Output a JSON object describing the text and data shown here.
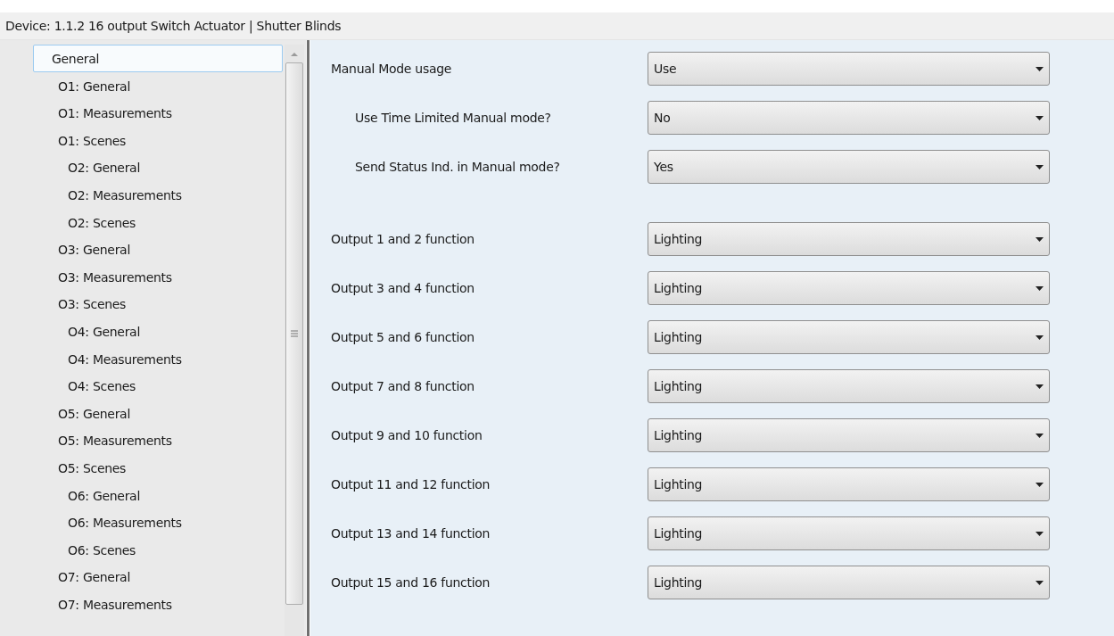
{
  "header": {
    "title": "Device: 1.1.2  16 output Switch Actuator | Shutter Blinds"
  },
  "tree": [
    {
      "label": "General",
      "selected": true,
      "children": [
        {
          "label": "O1: General",
          "selected": false
        },
        {
          "label": "O1: Measurements",
          "selected": false
        },
        {
          "label": "O1: Scenes",
          "selected": false,
          "children": [
            {
              "label": "O2: General",
              "selected": false
            },
            {
              "label": "O2: Measurements",
              "selected": false
            },
            {
              "label": "O2: Scenes",
              "selected": false
            }
          ]
        },
        {
          "label": "O3: General",
          "selected": false
        },
        {
          "label": "O3: Measurements",
          "selected": false
        },
        {
          "label": "O3: Scenes",
          "selected": false,
          "children": [
            {
              "label": "O4: General",
              "selected": false
            },
            {
              "label": "O4: Measurements",
              "selected": false
            },
            {
              "label": "O4: Scenes",
              "selected": false
            }
          ]
        },
        {
          "label": "O5: General",
          "selected": false
        },
        {
          "label": "O5: Measurements",
          "selected": false
        },
        {
          "label": "O5: Scenes",
          "selected": false,
          "children": [
            {
              "label": "O6: General",
              "selected": false
            },
            {
              "label": "O6: Measurements",
              "selected": false
            },
            {
              "label": "O6: Scenes",
              "selected": false
            }
          ]
        },
        {
          "label": "O7: General",
          "selected": false
        },
        {
          "label": "O7: Measurements",
          "selected": false
        }
      ]
    }
  ],
  "groups": [
    [
      {
        "label": "Manual Mode usage",
        "value": "Use",
        "children": [
          {
            "label": "Use Time Limited Manual mode?",
            "value": "No"
          },
          {
            "label": "Send Status Ind. in Manual mode?",
            "value": "Yes"
          }
        ]
      }
    ],
    [
      {
        "label": "Output 1 and 2 function",
        "value": "Lighting"
      },
      {
        "label": "Output 3 and 4 function",
        "value": "Lighting"
      },
      {
        "label": "Output 5 and 6 function",
        "value": "Lighting"
      },
      {
        "label": "Output 7 and 8 function",
        "value": "Lighting"
      },
      {
        "label": "Output 9 and 10 function",
        "value": "Lighting"
      },
      {
        "label": "Output 11 and 12 function",
        "value": "Lighting"
      },
      {
        "label": "Output 13 and 14 function",
        "value": "Lighting"
      },
      {
        "label": "Output 15 and 16 function",
        "value": "Lighting"
      }
    ]
  ]
}
